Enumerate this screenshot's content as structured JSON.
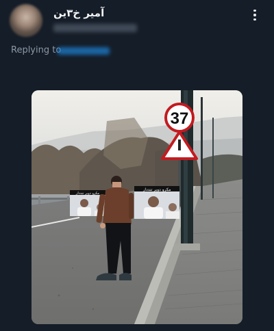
{
  "tweet": {
    "author_name": "آمیر خ۳ین",
    "replying_label": "Replying to"
  },
  "media": {
    "sign_speed_number": "37",
    "meme_caption": "مکرو دوپر تنددار"
  },
  "icons": [
    "more-icon"
  ],
  "colors": {
    "background": "#151d28",
    "link": "#1d9bf0",
    "muted": "#8b98a5"
  }
}
